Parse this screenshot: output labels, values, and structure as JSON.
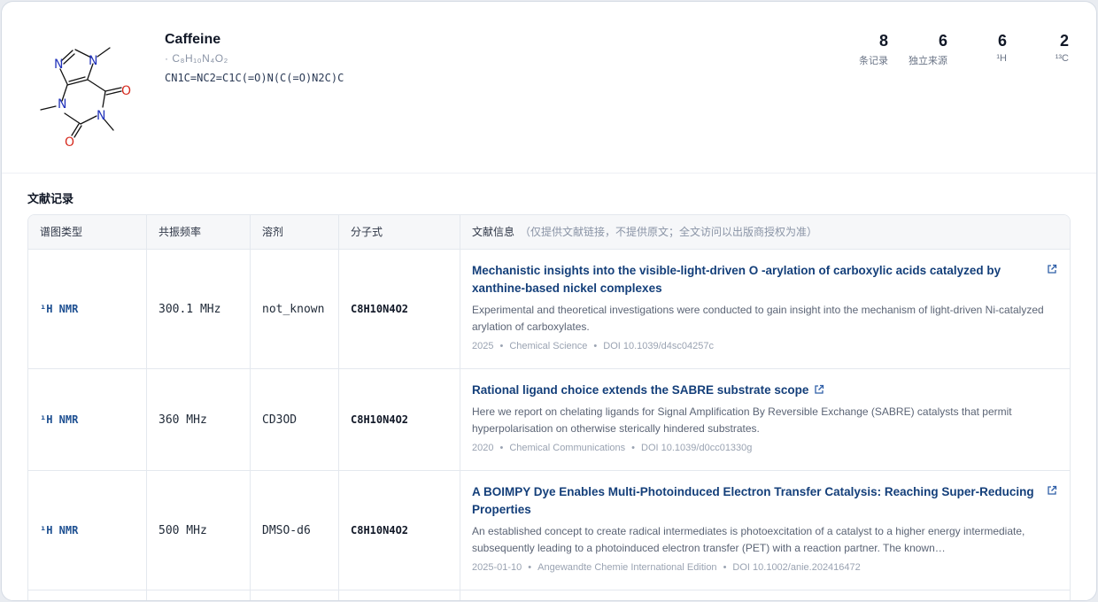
{
  "compound": {
    "name": "Caffeine",
    "formula": "· C₈H₁₀N₄O₂",
    "smiles": "CN1C=NC2=C1C(=O)N(C(=O)N2C)C",
    "atoms": {
      "n": "N",
      "o": "O"
    }
  },
  "stats": [
    {
      "value": "8",
      "label": "条记录"
    },
    {
      "value": "6",
      "label": "独立来源"
    },
    {
      "value": "6",
      "label": "¹H"
    },
    {
      "value": "2",
      "label": "¹³C"
    }
  ],
  "section_title": "文献记录",
  "table": {
    "headers": {
      "type": "谱图类型",
      "freq": "共振频率",
      "solvent": "溶剂",
      "formula": "分子式",
      "lit": "文献信息",
      "lit_note": "（仅提供文献链接，不提供原文；全文访问以出版商授权为准）"
    },
    "rows": [
      {
        "type": "¹H NMR",
        "freq": "300.1 MHz",
        "solvent": "not_known",
        "formula": "C8H10N4O2",
        "title": "Mechanistic insights into the visible-light-driven O -arylation of carboxylic acids catalyzed by xanthine-based nickel complexes",
        "abstract": "Experimental and theoretical investigations were conducted to gain insight into the mechanism of light-driven Ni-catalyzed arylation of carboxylates.",
        "year": "2025",
        "journal": "Chemical Science",
        "doi": "DOI 10.1039/d4sc04257c"
      },
      {
        "type": "¹H NMR",
        "freq": "360 MHz",
        "solvent": "CD3OD",
        "formula": "C8H10N4O2",
        "title": "Rational ligand choice extends the SABRE substrate scope",
        "abstract": "Here we report on chelating ligands for Signal Amplification By Reversible Exchange (SABRE) catalysts that permit hyperpolarisation on otherwise sterically hindered substrates.",
        "year": "2020",
        "journal": "Chemical Communications",
        "doi": "DOI 10.1039/d0cc01330g"
      },
      {
        "type": "¹H NMR",
        "freq": "500 MHz",
        "solvent": "DMSO-d6",
        "formula": "C8H10N4O2",
        "title": "A BOIMPY Dye Enables Multi-Photoinduced Electron Transfer Catalysis: Reaching Super-Reducing Properties",
        "abstract": "An established concept to create radical intermediates is photoexcitation of a catalyst to a higher energy intermediate, subsequently leading to a photoinduced electron transfer (PET) with a reaction partner. The known…",
        "year": "2025-01-10",
        "journal": "Angewandte Chemie International Edition",
        "doi": "DOI 10.1002/anie.202416472"
      }
    ]
  },
  "colors": {
    "link": "#143f7a",
    "accent": "#1d4f91",
    "oxygen": "#d62a1e",
    "nitrogen": "#2233bb"
  }
}
